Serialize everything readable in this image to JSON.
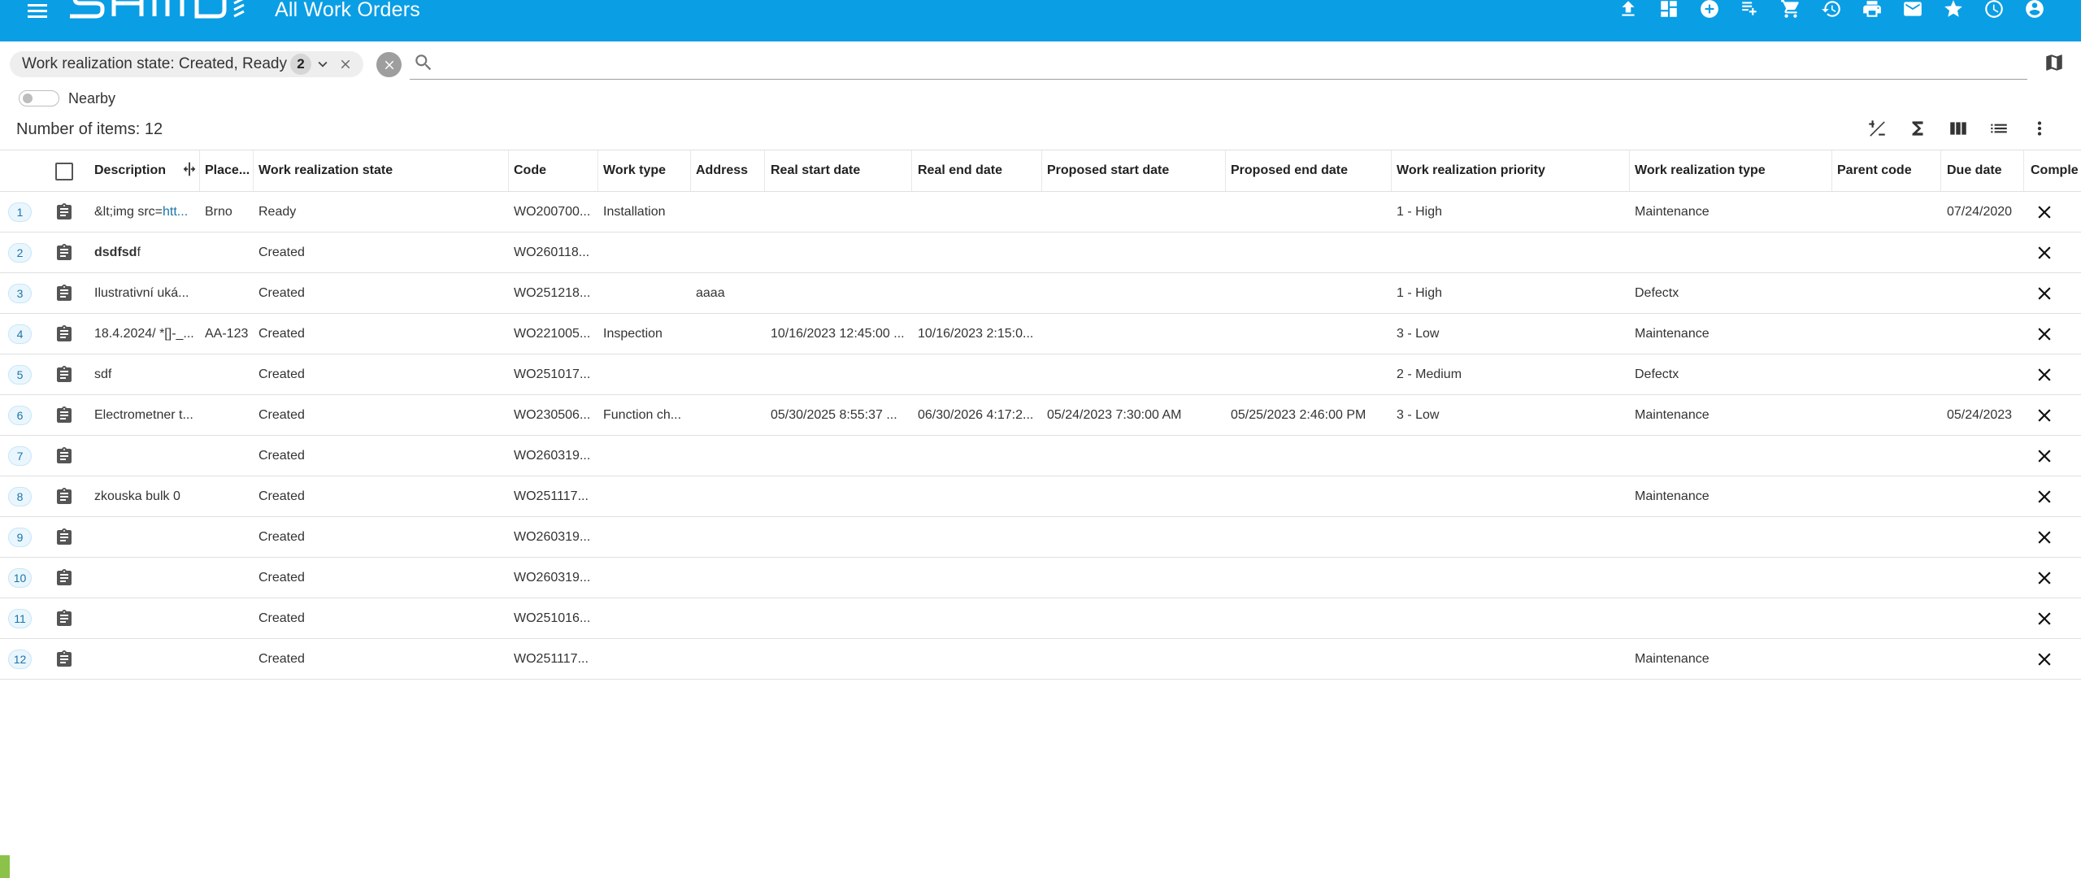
{
  "header": {
    "title": "All Work Orders",
    "brand_color": "#0a9ee5",
    "logo_text": "SAMO",
    "icons": [
      "upload-icon",
      "dashboard-icon",
      "add-circle-icon",
      "playlist-add-icon",
      "cart-icon",
      "history-icon",
      "print-icon",
      "mail-icon",
      "star-icon",
      "timer-icon",
      "account-icon"
    ]
  },
  "filter": {
    "chip_label": "Work realization state: Created, Ready",
    "chip_count": "2",
    "search_placeholder": "",
    "search_value": ""
  },
  "nearby": {
    "label": "Nearby",
    "checked": false
  },
  "list": {
    "count_label": "Number of items: 12",
    "tools": [
      "add-remove-icon",
      "sum-icon",
      "columns-icon",
      "list-view-icon",
      "more-vert-icon"
    ]
  },
  "table": {
    "headers": {
      "description": "Description",
      "place": "Place...",
      "state": "Work realization state",
      "code": "Code",
      "work_type": "Work type",
      "address": "Address",
      "real_start": "Real start date",
      "real_end": "Real end date",
      "proposed_start": "Proposed start date",
      "proposed_end": "Proposed end date",
      "priority": "Work realization priority",
      "wr_type": "Work realization type",
      "parent_code": "Parent code",
      "due_date": "Due date",
      "complete": "Comple"
    },
    "rows": [
      {
        "num": "1",
        "description_plain": "&lt;img src=",
        "description_link": "htt...",
        "place": "Brno",
        "state": "Ready",
        "code": "WO200700...",
        "work_type": "Installation",
        "address": "",
        "real_start": "",
        "real_end": "",
        "proposed_start": "",
        "proposed_end": "",
        "priority": "1 - High",
        "wr_type": "Maintenance",
        "parent_code": "",
        "due_date": "07/24/2020"
      },
      {
        "num": "2",
        "description_bold": "dsdfsd",
        "description_plain": "f",
        "place": "",
        "state": "Created",
        "code": "WO260118...",
        "work_type": "",
        "address": "",
        "real_start": "",
        "real_end": "",
        "proposed_start": "",
        "proposed_end": "",
        "priority": "",
        "wr_type": "",
        "parent_code": "",
        "due_date": ""
      },
      {
        "num": "3",
        "description_plain": "Ilustrativní uká...",
        "place": "",
        "state": "Created",
        "code": "WO251218...",
        "work_type": "",
        "address": "aaaa",
        "real_start": "",
        "real_end": "",
        "proposed_start": "",
        "proposed_end": "",
        "priority": "1 - High",
        "wr_type": "Defectx",
        "parent_code": "",
        "due_date": ""
      },
      {
        "num": "4",
        "description_plain": "18.4.2024/ *[]-_...",
        "place": "AA-123",
        "state": "Created",
        "code": "WO221005...",
        "work_type": "Inspection",
        "address": "",
        "real_start": "10/16/2023 12:45:00 ...",
        "real_end": "10/16/2023 2:15:0...",
        "proposed_start": "",
        "proposed_end": "",
        "priority": "3 - Low",
        "wr_type": "Maintenance",
        "parent_code": "",
        "due_date": ""
      },
      {
        "num": "5",
        "description_plain": "sdf",
        "place": "",
        "state": "Created",
        "code": "WO251017...",
        "work_type": "",
        "address": "",
        "real_start": "",
        "real_end": "",
        "proposed_start": "",
        "proposed_end": "",
        "priority": "2 - Medium",
        "wr_type": "Defectx",
        "parent_code": "",
        "due_date": ""
      },
      {
        "num": "6",
        "description_plain": "Electrometner t...",
        "place": "",
        "state": "Created",
        "code": "WO230506...",
        "work_type": "Function ch...",
        "address": "",
        "real_start": "05/30/2025 8:55:37 ...",
        "real_end": "06/30/2026 4:17:2...",
        "proposed_start": "05/24/2023 7:30:00 AM",
        "proposed_end": "05/25/2023 2:46:00 PM",
        "priority": "3 - Low",
        "wr_type": "Maintenance",
        "parent_code": "",
        "due_date": "05/24/2023"
      },
      {
        "num": "7",
        "description_plain": "",
        "place": "",
        "state": "Created",
        "code": "WO260319...",
        "work_type": "",
        "address": "",
        "real_start": "",
        "real_end": "",
        "proposed_start": "",
        "proposed_end": "",
        "priority": "",
        "wr_type": "",
        "parent_code": "",
        "due_date": ""
      },
      {
        "num": "8",
        "description_plain": "zkouska bulk 0",
        "place": "",
        "state": "Created",
        "code": "WO251117...",
        "work_type": "",
        "address": "",
        "real_start": "",
        "real_end": "",
        "proposed_start": "",
        "proposed_end": "",
        "priority": "",
        "wr_type": "Maintenance",
        "parent_code": "",
        "due_date": ""
      },
      {
        "num": "9",
        "description_plain": "",
        "place": "",
        "state": "Created",
        "code": "WO260319...",
        "work_type": "",
        "address": "",
        "real_start": "",
        "real_end": "",
        "proposed_start": "",
        "proposed_end": "",
        "priority": "",
        "wr_type": "",
        "parent_code": "",
        "due_date": ""
      },
      {
        "num": "10",
        "description_plain": "",
        "place": "",
        "state": "Created",
        "code": "WO260319...",
        "work_type": "",
        "address": "",
        "real_start": "",
        "real_end": "",
        "proposed_start": "",
        "proposed_end": "",
        "priority": "",
        "wr_type": "",
        "parent_code": "",
        "due_date": ""
      },
      {
        "num": "11",
        "description_plain": "",
        "place": "",
        "state": "Created",
        "code": "WO251016...",
        "work_type": "",
        "address": "",
        "real_start": "",
        "real_end": "",
        "proposed_start": "",
        "proposed_end": "",
        "priority": "",
        "wr_type": "",
        "parent_code": "",
        "due_date": ""
      },
      {
        "num": "12",
        "description_plain": "",
        "place": "",
        "state": "Created",
        "code": "WO251117...",
        "work_type": "",
        "address": "",
        "real_start": "",
        "real_end": "",
        "proposed_start": "",
        "proposed_end": "",
        "priority": "",
        "wr_type": "Maintenance",
        "parent_code": "",
        "due_date": ""
      }
    ]
  }
}
